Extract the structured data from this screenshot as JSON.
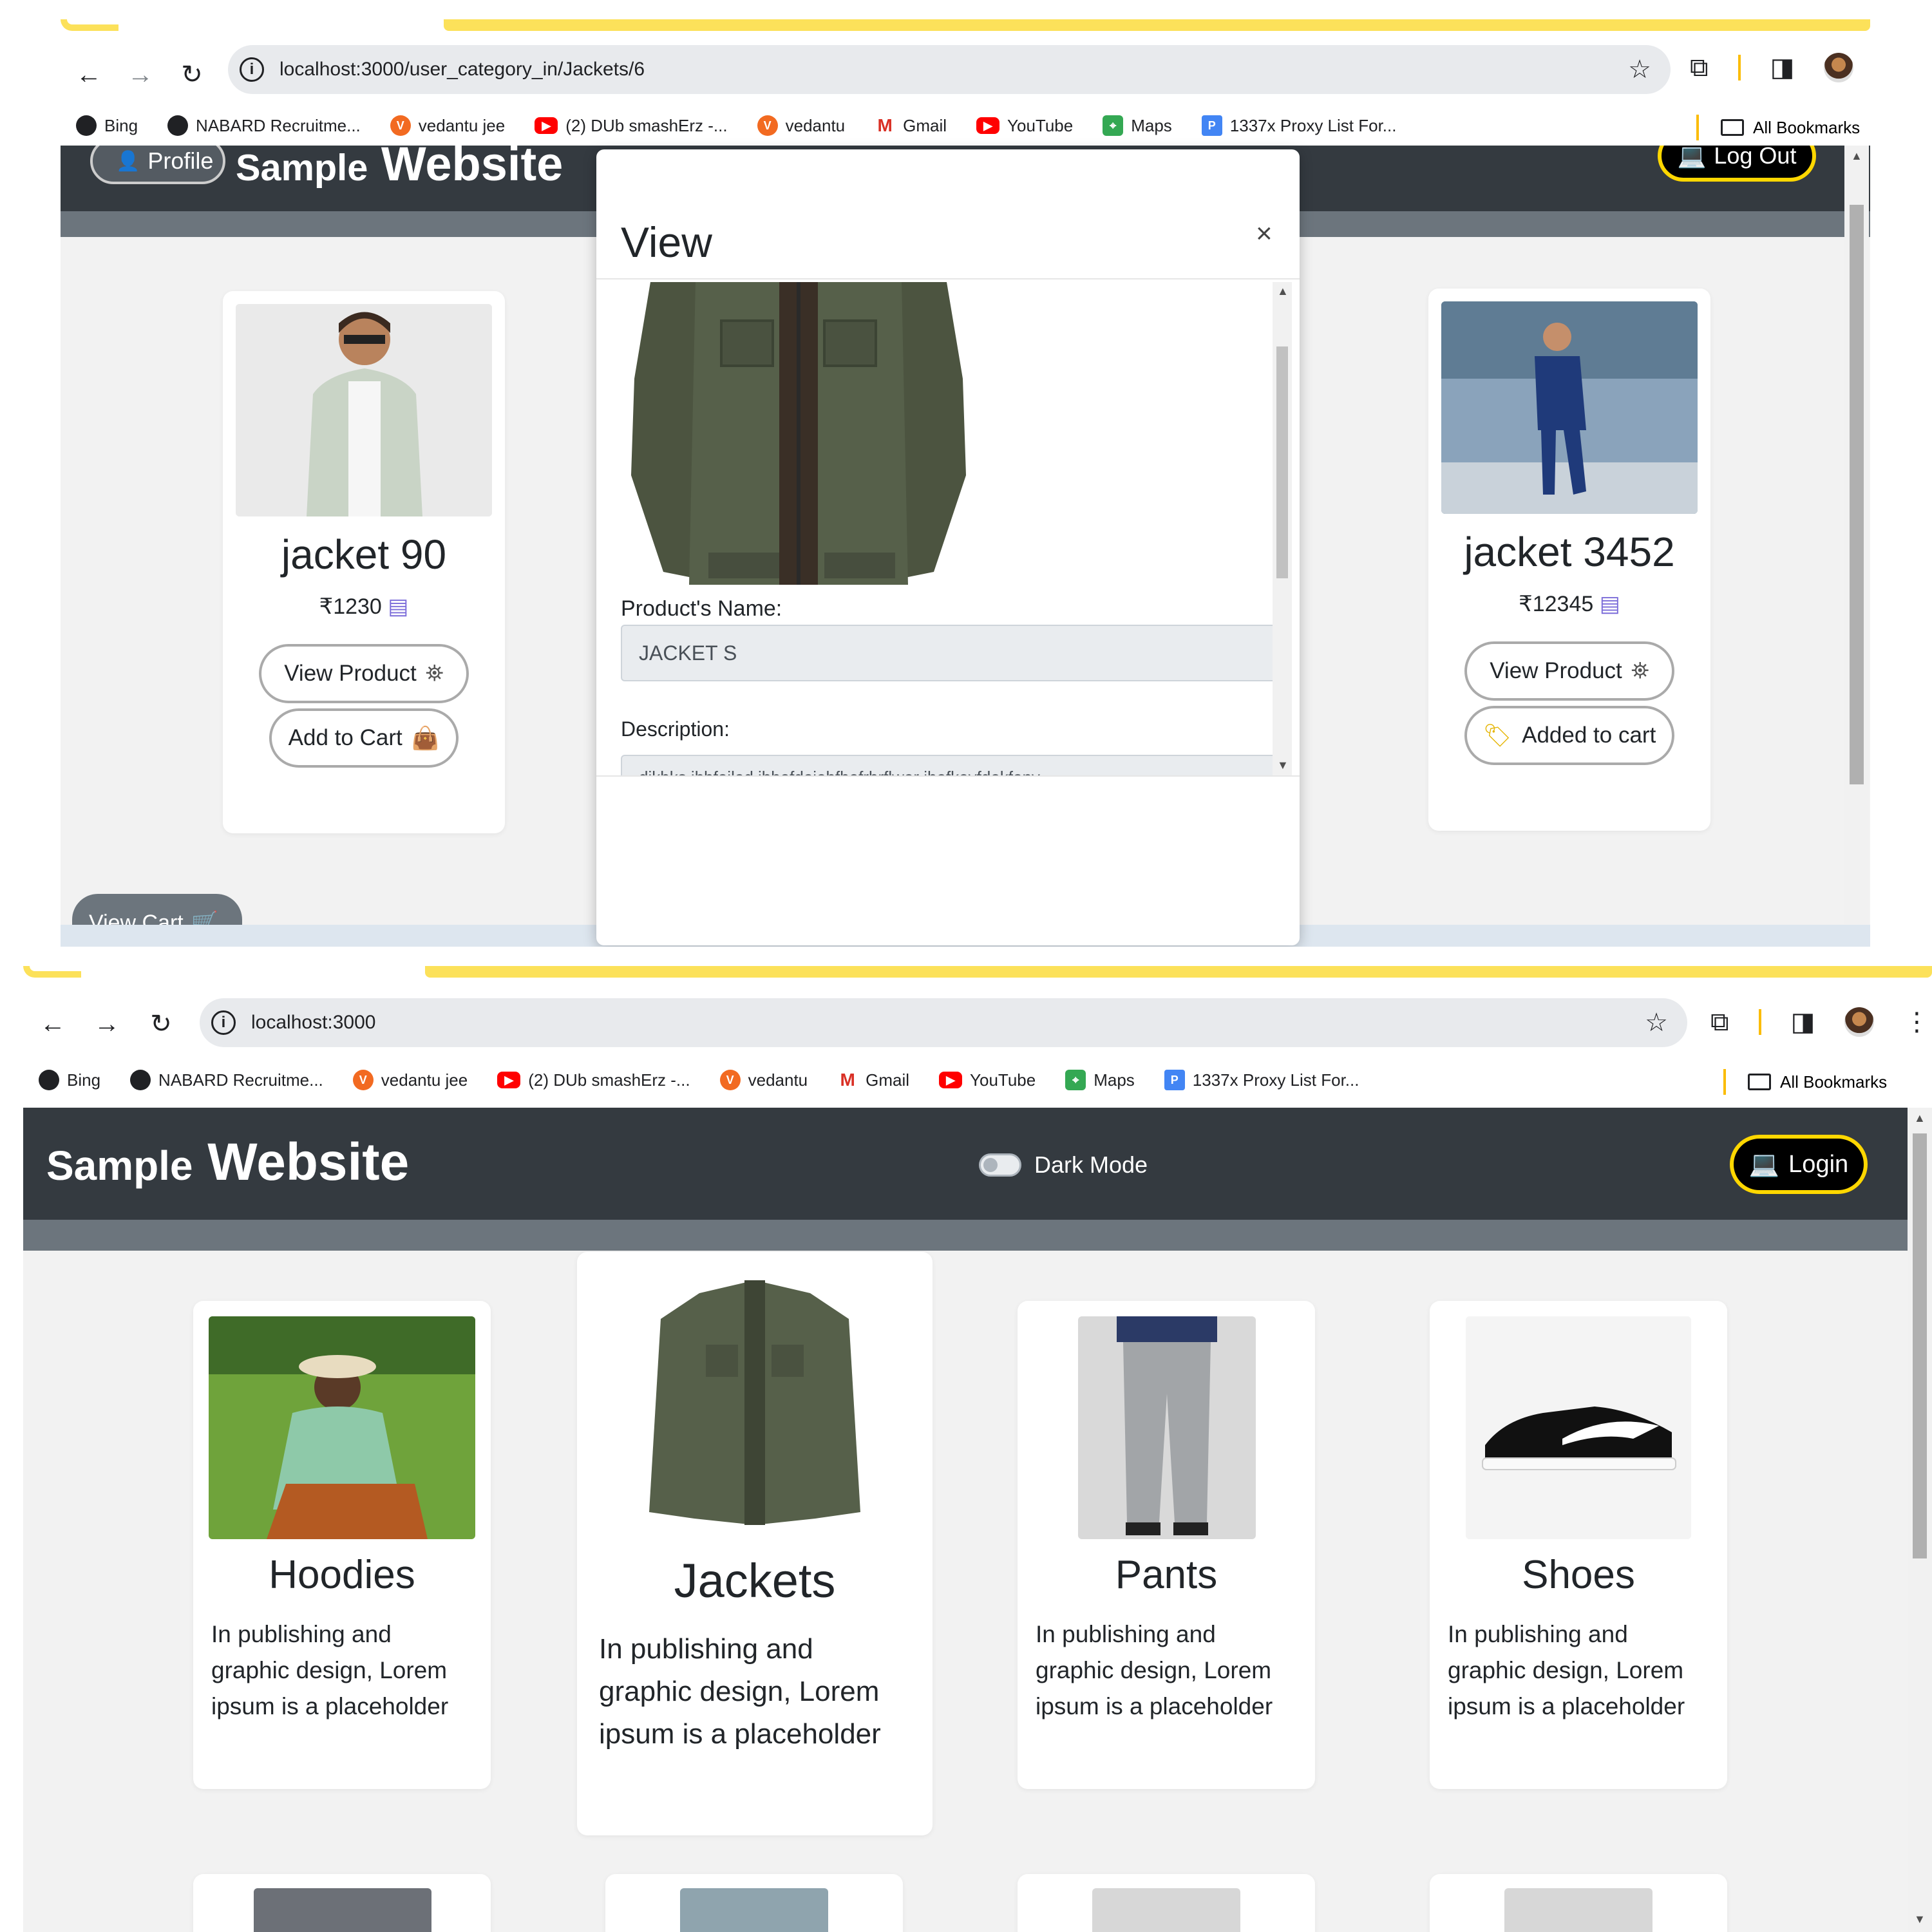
{
  "shot1": {
    "browser": {
      "url": "localhost:3000/user_category_in/Jackets/6",
      "bookmarks": [
        "Bing",
        "NABARD Recruitme...",
        "vedantu jee",
        "(2) DUb smashErz -...",
        "vedantu",
        "Gmail",
        "YouTube",
        "Maps",
        "1337x Proxy List For..."
      ],
      "all_bookmarks": "All Bookmarks"
    },
    "site": {
      "brand_small": "Sample",
      "brand_large": "Website",
      "profile_button": "Profile",
      "logout_button": "Log Out"
    },
    "cards": [
      {
        "name": "jacket 90",
        "price": "₹1230",
        "view_button": "View Product",
        "cart_button": "Add to Cart"
      },
      {
        "name": "jacket 3452",
        "price": "₹12345",
        "view_button": "View Product",
        "cart_button": "Added to cart"
      }
    ],
    "modal": {
      "title": "View",
      "close": "×",
      "name_label": "Product's Name:",
      "name_value": "JACKET S",
      "description_label": "Description:",
      "description_value": "dikhks ihbfoiled ihbefdeiehfbefrbrflwer ihefkeyfdekfenv"
    },
    "view_cart": "View Cart"
  },
  "shot2": {
    "browser": {
      "url": "localhost:3000",
      "bookmarks": [
        "Bing",
        "NABARD Recruitme...",
        "vedantu jee",
        "(2) DUb smashErz -...",
        "vedantu",
        "Gmail",
        "YouTube",
        "Maps",
        "1337x Proxy List For..."
      ],
      "all_bookmarks": "All Bookmarks"
    },
    "site": {
      "brand_small": "Sample",
      "brand_large": "Website",
      "dark_mode_label": "Dark Mode",
      "login_button": "Login"
    },
    "categories": [
      {
        "name": "Hoodies",
        "description": "In publishing and graphic design, Lorem ipsum is a placeholder"
      },
      {
        "name": "Jackets",
        "description": "In publishing and graphic design, Lorem ipsum is a placeholder"
      },
      {
        "name": "Pants",
        "description": "In publishing and graphic design, Lorem ipsum is a placeholder"
      },
      {
        "name": "Shoes",
        "description": "In publishing and graphic design, Lorem ipsum is a placeholder"
      }
    ]
  },
  "colors": {
    "navbar": "#343a40",
    "strip": "#6c757d",
    "accent_yellow": "#ffd700",
    "chrome_band": "#fce15a"
  }
}
